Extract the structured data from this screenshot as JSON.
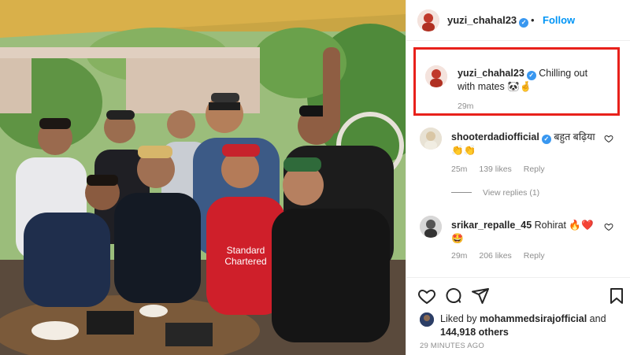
{
  "post": {
    "image_alt": "Group photo of friends at a restaurant table",
    "jersey_text": [
      "Standard",
      "Chartered"
    ]
  },
  "header": {
    "username": "yuzi_chahal23",
    "verified_icon": "verified-badge-icon",
    "separator": "•",
    "follow_label": "Follow"
  },
  "caption": {
    "username": "yuzi_chahal23",
    "text": "Chilling out with mates 🐼🤞",
    "time": "29m"
  },
  "comments": [
    {
      "username": "shooterdadiofficial",
      "text": "बहुत बढ़िया 👏👏",
      "time": "25m",
      "likes": "139 likes",
      "reply": "Reply",
      "view_replies": "View replies (1)"
    },
    {
      "username": "srikar_repalle_45",
      "text": "Rohirat 🔥❤️🤩",
      "time": "29m",
      "likes": "206 likes",
      "reply": "Reply"
    }
  ],
  "actions": {
    "icons": [
      "heart-icon",
      "comment-icon",
      "share-icon",
      "bookmark-icon"
    ]
  },
  "likes": {
    "prefix": "Liked by ",
    "user": "mohammedsirajofficial",
    "middle": " and ",
    "others": "144,918 others"
  },
  "timeago": "29 MINUTES AGO",
  "colors": {
    "follow": "#0095f6",
    "highlight_box": "#e8211b",
    "verified": "#3897f0",
    "muted": "#8e8e8e"
  }
}
